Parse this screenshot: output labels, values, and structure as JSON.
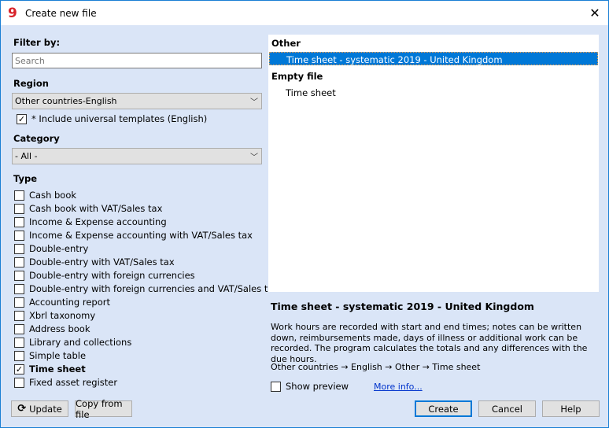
{
  "window": {
    "title": "Create new file",
    "logo": "9"
  },
  "filter": {
    "label": "Filter by:",
    "search_placeholder": "Search"
  },
  "region": {
    "label": "Region",
    "value": "Other countries-English",
    "include_universal": {
      "label": "* Include universal templates (English)",
      "checked": true
    }
  },
  "category": {
    "label": "Category",
    "value": "- All -"
  },
  "type": {
    "label": "Type",
    "items": [
      {
        "label": "Cash book",
        "checked": false
      },
      {
        "label": "Cash book with VAT/Sales tax",
        "checked": false
      },
      {
        "label": "Income & Expense accounting",
        "checked": false
      },
      {
        "label": "Income & Expense accounting with VAT/Sales tax",
        "checked": false
      },
      {
        "label": "Double-entry",
        "checked": false
      },
      {
        "label": "Double-entry with VAT/Sales tax",
        "checked": false
      },
      {
        "label": "Double-entry with foreign currencies",
        "checked": false
      },
      {
        "label": "Double-entry with foreign currencies and VAT/Sales tax",
        "checked": false
      },
      {
        "label": "Accounting report",
        "checked": false
      },
      {
        "label": "Xbrl taxonomy",
        "checked": false
      },
      {
        "label": "Address book",
        "checked": false
      },
      {
        "label": "Library and collections",
        "checked": false
      },
      {
        "label": "Simple table",
        "checked": false
      },
      {
        "label": "Time sheet",
        "checked": true
      },
      {
        "label": "Fixed asset register",
        "checked": false
      }
    ]
  },
  "templates": {
    "groups": [
      {
        "name": "Other",
        "items": [
          {
            "label": "Time sheet - systematic 2019 - United Kingdom",
            "selected": true
          }
        ]
      },
      {
        "name": "Empty file",
        "items": [
          {
            "label": "Time sheet",
            "selected": false
          }
        ]
      }
    ]
  },
  "details": {
    "title": "Time sheet - systematic 2019 - United Kingdom",
    "description": "Work hours are recorded with start and end times; notes can be written down, reimbursements made, days of illness or additional work can be recorded. The program calculates the totals and any differences with the due hours.",
    "path": "Other countries → English → Other → Time sheet",
    "show_preview": "Show preview",
    "more_info": "More info..."
  },
  "buttons": {
    "update": "Update",
    "copy_from_file": "Copy from file",
    "create": "Create",
    "cancel": "Cancel",
    "help": "Help"
  },
  "colors": {
    "accent": "#0078d7",
    "background": "#dae5f7"
  }
}
